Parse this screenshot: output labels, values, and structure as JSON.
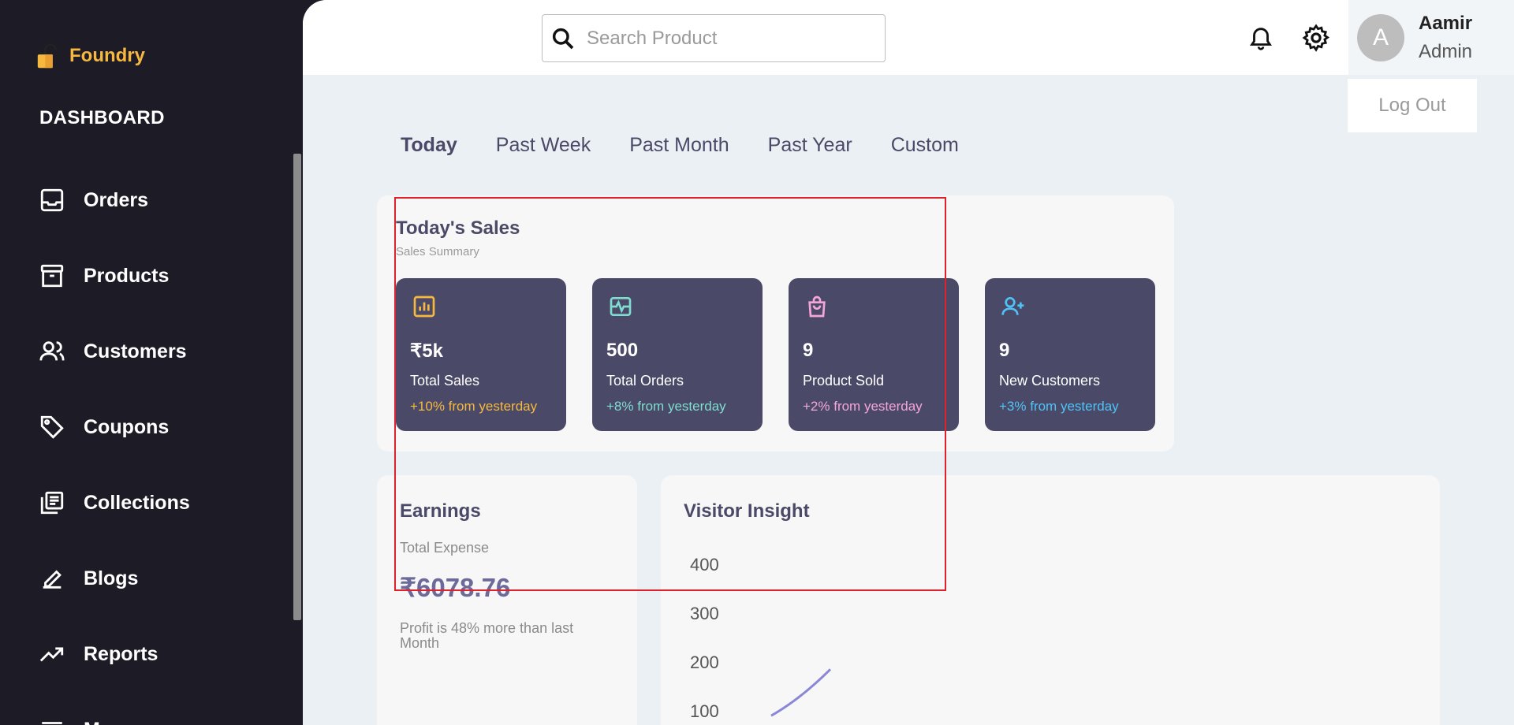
{
  "brand": {
    "name": "Foundry",
    "logo_icon": "lock-icon"
  },
  "sidebar": {
    "section_label": "DASHBOARD",
    "items": [
      {
        "label": "Orders",
        "icon": "inbox-icon"
      },
      {
        "label": "Products",
        "icon": "archive-icon"
      },
      {
        "label": "Customers",
        "icon": "users-icon"
      },
      {
        "label": "Coupons",
        "icon": "tag-icon"
      },
      {
        "label": "Collections",
        "icon": "library-icon"
      },
      {
        "label": "Blogs",
        "icon": "edit-icon"
      },
      {
        "label": "Reports",
        "icon": "trending-up-icon"
      },
      {
        "label": "Ma",
        "icon": "list-icon"
      }
    ]
  },
  "search": {
    "placeholder": "Search Product",
    "value": ""
  },
  "user": {
    "avatar_initial": "A",
    "name": "Aamir",
    "role": "Admin",
    "logout_label": "Log Out"
  },
  "tabs": [
    {
      "label": "Today",
      "active": true
    },
    {
      "label": "Past Week",
      "active": false
    },
    {
      "label": "Past Month",
      "active": false
    },
    {
      "label": "Past Year",
      "active": false
    },
    {
      "label": "Custom",
      "active": false
    }
  ],
  "sales": {
    "title": "Today's Sales",
    "subtitle": "Sales Summary",
    "stats": [
      {
        "value": "₹5k",
        "label": "Total Sales",
        "change": "+10% from yesterday",
        "icon": "bar-chart-icon",
        "color": "#f6b83e"
      },
      {
        "value": "500",
        "label": "Total Orders",
        "change": "+8% from yesterday",
        "icon": "activity-icon",
        "color": "#7fdccf"
      },
      {
        "value": "9",
        "label": "Product Sold",
        "change": "+2% from yesterday",
        "icon": "shopping-bag-icon",
        "color": "#f4a6d7"
      },
      {
        "value": "9",
        "label": "New Customers",
        "change": "+3% from yesterday",
        "icon": "user-plus-icon",
        "color": "#4fc3f7"
      }
    ]
  },
  "earnings": {
    "title": "Earnings",
    "subtitle": "Total Expense",
    "amount": "₹6078.76",
    "note": "Profit is 48% more than last Month"
  },
  "visitor": {
    "title": "Visitor Insight",
    "line_color": "#8b87d8"
  },
  "chart_data": {
    "type": "line",
    "title": "Visitor Insight",
    "yticks": [
      400,
      300,
      200,
      100
    ],
    "series": [
      {
        "values": [
          [
            0,
            90
          ],
          [
            1,
            185
          ]
        ]
      }
    ]
  }
}
